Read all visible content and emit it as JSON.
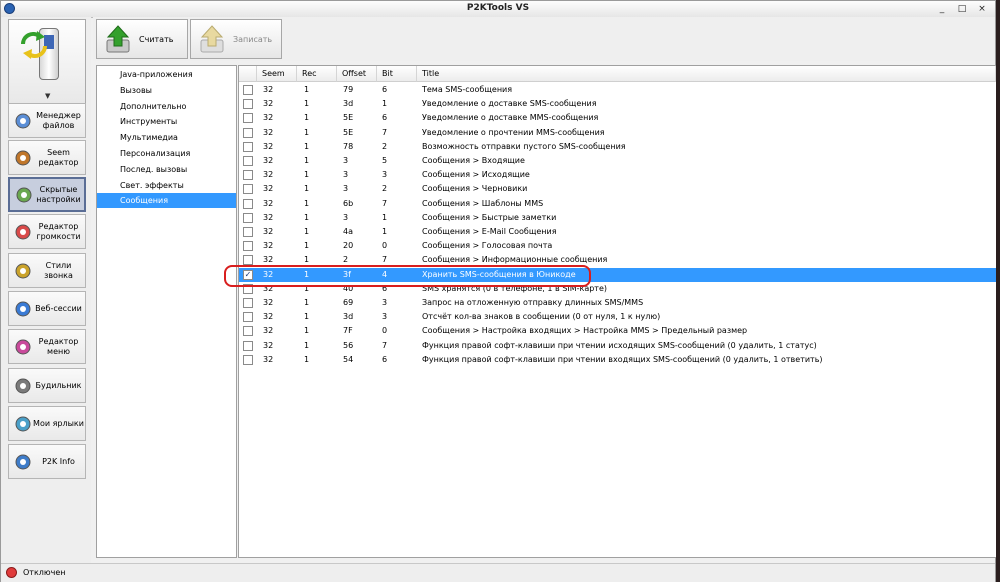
{
  "window": {
    "title": "P2KTools VS"
  },
  "window_controls": {
    "minimize": "_",
    "maximize": "□",
    "close": "×"
  },
  "left_nav": [
    {
      "label": "Менеджер\nфайлов",
      "icon": "file-manager-icon",
      "active": false
    },
    {
      "label": "Seem\nредактор",
      "icon": "seem-editor-icon",
      "active": false
    },
    {
      "label": "Скрытые\nнастройки",
      "icon": "hidden-settings-icon",
      "active": true
    },
    {
      "label": "Редактор\nгромкости",
      "icon": "volume-editor-icon",
      "active": false
    },
    {
      "label": "Стили\nзвонка",
      "icon": "ring-style-icon",
      "active": false
    },
    {
      "label": "Веб-сессии",
      "icon": "web-sessions-icon",
      "active": false
    },
    {
      "label": "Редактор\nменю",
      "icon": "menu-editor-icon",
      "active": false
    },
    {
      "label": "Будильник",
      "icon": "alarm-icon",
      "active": false
    },
    {
      "label": "Мои ярлыки",
      "icon": "shortcuts-icon",
      "active": false
    },
    {
      "label": "P2K Info",
      "icon": "info-icon",
      "active": false
    }
  ],
  "toolbar": {
    "read_label": "Считать",
    "write_label": "Записать"
  },
  "categories": [
    "Java-приложения",
    "Вызовы",
    "Дополнительно",
    "Инструменты",
    "Мультимедиа",
    "Персонализация",
    "Послед. вызовы",
    "Свет. эффекты",
    "Сообщения"
  ],
  "selected_category": 8,
  "columns": [
    "Seem",
    "Rec",
    "Offset",
    "Bit",
    "Title"
  ],
  "rows": [
    {
      "checked": false,
      "seem": "32",
      "rec": "1",
      "offset": "79",
      "bit": "6",
      "title": "Тема SMS-сообщения"
    },
    {
      "checked": false,
      "seem": "32",
      "rec": "1",
      "offset": "3d",
      "bit": "1",
      "title": "Уведомление о доставке SMS-сообщения"
    },
    {
      "checked": false,
      "seem": "32",
      "rec": "1",
      "offset": "5E",
      "bit": "6",
      "title": "Уведомление о доставке MMS-сообщения"
    },
    {
      "checked": false,
      "seem": "32",
      "rec": "1",
      "offset": "5E",
      "bit": "7",
      "title": "Уведомление о прочтении MMS-сообщения"
    },
    {
      "checked": false,
      "seem": "32",
      "rec": "1",
      "offset": "78",
      "bit": "2",
      "title": "Возможность отправки пустого SMS-сообщения"
    },
    {
      "checked": false,
      "seem": "32",
      "rec": "1",
      "offset": "3",
      "bit": "5",
      "title": "Сообщения > Входящие"
    },
    {
      "checked": false,
      "seem": "32",
      "rec": "1",
      "offset": "3",
      "bit": "3",
      "title": "Сообщения > Исходящие"
    },
    {
      "checked": false,
      "seem": "32",
      "rec": "1",
      "offset": "3",
      "bit": "2",
      "title": "Сообщения > Черновики"
    },
    {
      "checked": false,
      "seem": "32",
      "rec": "1",
      "offset": "6b",
      "bit": "7",
      "title": "Сообщения > Шаблоны MMS"
    },
    {
      "checked": false,
      "seem": "32",
      "rec": "1",
      "offset": "3",
      "bit": "1",
      "title": "Сообщения > Быстрые заметки"
    },
    {
      "checked": false,
      "seem": "32",
      "rec": "1",
      "offset": "4a",
      "bit": "1",
      "title": "Сообщения > E-Mail Сообщения"
    },
    {
      "checked": false,
      "seem": "32",
      "rec": "1",
      "offset": "20",
      "bit": "0",
      "title": "Сообщения > Голосовая почта"
    },
    {
      "checked": false,
      "seem": "32",
      "rec": "1",
      "offset": "2",
      "bit": "7",
      "title": "Сообщения > Информационные сообщения"
    },
    {
      "checked": true,
      "seem": "32",
      "rec": "1",
      "offset": "3f",
      "bit": "4",
      "title": "Хранить SMS-сообщения в Юникоде"
    },
    {
      "checked": false,
      "seem": "32",
      "rec": "1",
      "offset": "40",
      "bit": "6",
      "title": "SMS хранятся (0 в телефоне, 1 в SIM-карте)"
    },
    {
      "checked": false,
      "seem": "32",
      "rec": "1",
      "offset": "69",
      "bit": "3",
      "title": "Запрос на отложенную отправку длинных SMS/MMS"
    },
    {
      "checked": false,
      "seem": "32",
      "rec": "1",
      "offset": "3d",
      "bit": "3",
      "title": "Отсчёт кол-ва знаков в сообщении (0 от нуля, 1 к нулю)"
    },
    {
      "checked": false,
      "seem": "32",
      "rec": "1",
      "offset": "7F",
      "bit": "0",
      "title": "Сообщения > Настройка входящих > Настройка MMS > Предельный размер"
    },
    {
      "checked": false,
      "seem": "32",
      "rec": "1",
      "offset": "56",
      "bit": "7",
      "title": "Функция правой софт-клавиши при чтении исходящих SMS-сообщений (0 удалить, 1 статус)"
    },
    {
      "checked": false,
      "seem": "32",
      "rec": "1",
      "offset": "54",
      "bit": "6",
      "title": "Функция правой софт-клавиши при чтении входящих SMS-сообщений (0 удалить, 1 ответить)"
    }
  ],
  "selected_row": 13,
  "status": {
    "text": "Отключен",
    "color": "#e03b3b"
  },
  "colors": {
    "selection": "#3399ff",
    "annotation": "#d81e1e"
  }
}
